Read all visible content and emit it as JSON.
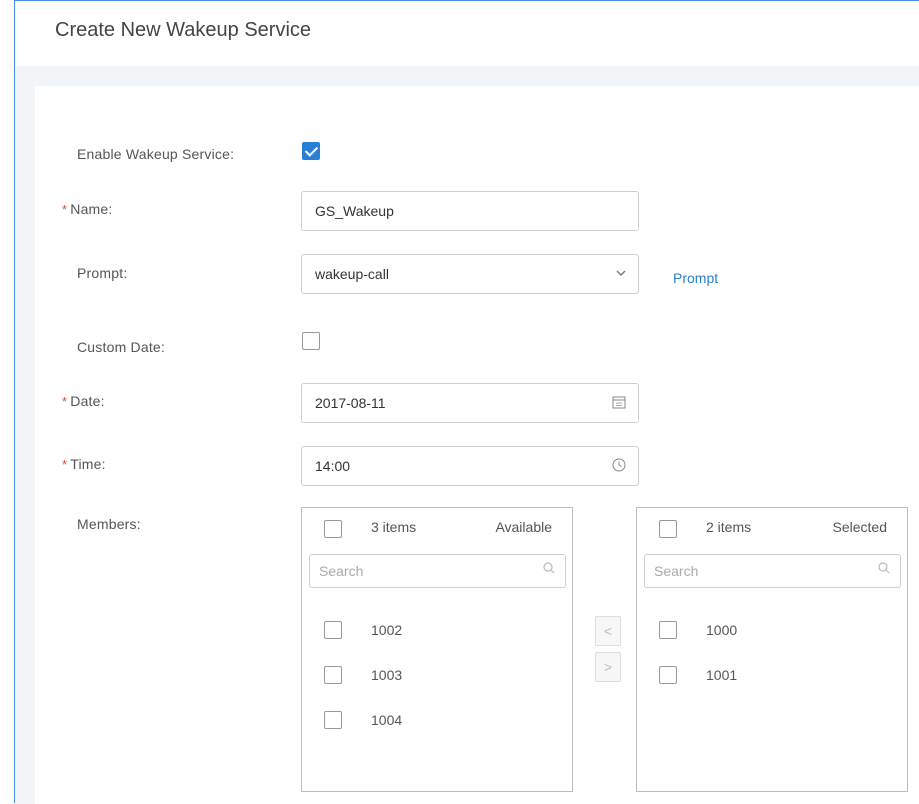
{
  "header": {
    "title": "Create New Wakeup Service"
  },
  "form": {
    "enable": {
      "label": "Enable Wakeup Service:",
      "checked": true
    },
    "name": {
      "label": "Name:",
      "value": "GS_Wakeup"
    },
    "prompt": {
      "label": "Prompt:",
      "value": "wakeup-call",
      "link": "Prompt"
    },
    "custom_date": {
      "label": "Custom Date:",
      "checked": false
    },
    "date": {
      "label": "Date:",
      "value": "2017-08-11"
    },
    "time": {
      "label": "Time:",
      "value": "14:00"
    },
    "members_label": "Members:",
    "required_mark": "*"
  },
  "members": {
    "available": {
      "count": "3 items",
      "title": "Available",
      "search_placeholder": "Search",
      "items": [
        "1002",
        "1003",
        "1004"
      ]
    },
    "selected": {
      "count": "2 items",
      "title": "Selected",
      "search_placeholder": "Search",
      "items": [
        "1000",
        "1001"
      ]
    },
    "move_left": "<",
    "move_right": ">"
  },
  "icons": {
    "chevron": "chevron-down-icon",
    "calendar": "calendar-icon",
    "clock": "clock-icon",
    "search": "search-icon"
  },
  "colors": {
    "accent": "#2a7ed3",
    "required": "#e0473d"
  }
}
